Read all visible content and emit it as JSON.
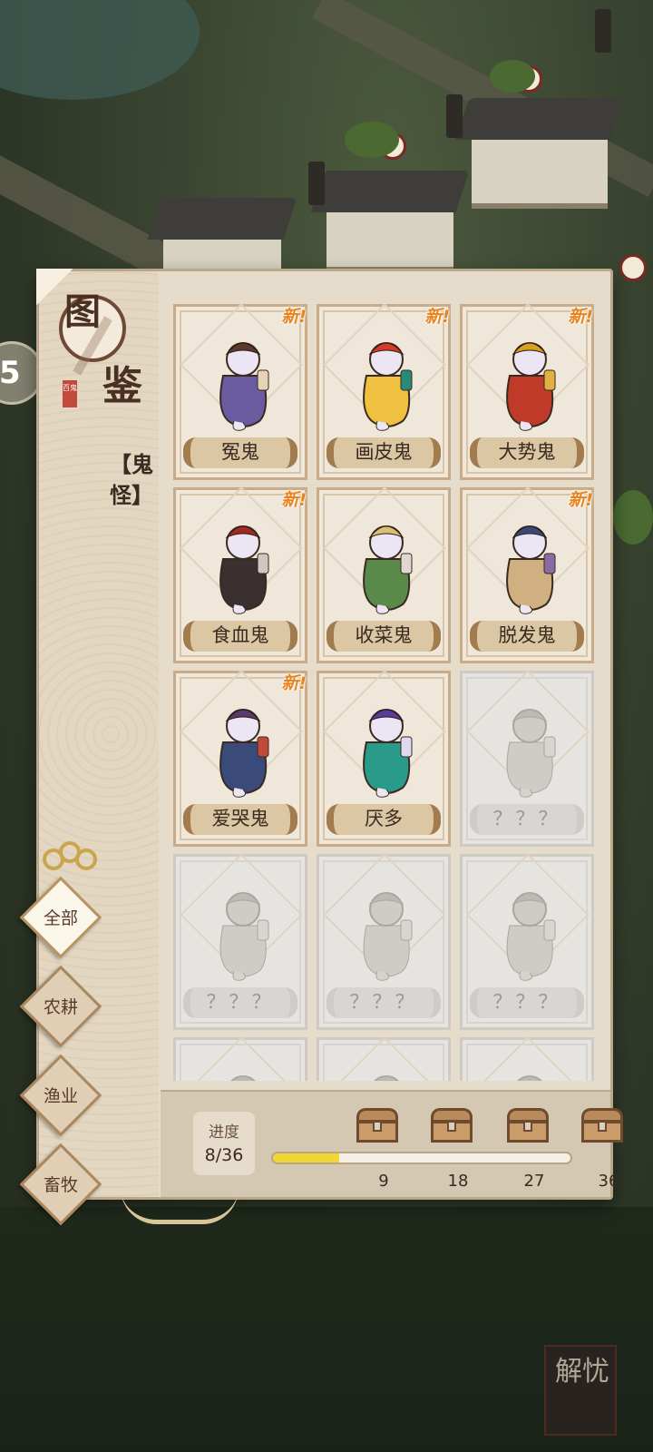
{
  "panel": {
    "title": [
      "图",
      "鉴"
    ],
    "seal_text": "百鬼",
    "category": "【鬼怪】"
  },
  "tabs": [
    {
      "label": "全部",
      "active": true
    },
    {
      "label": "农耕",
      "active": false
    },
    {
      "label": "渔业",
      "active": false
    },
    {
      "label": "畜牧",
      "active": false
    }
  ],
  "new_badge": "新!",
  "cards": [
    {
      "name": "冤鬼",
      "new": true,
      "locked": false
    },
    {
      "name": "画皮鬼",
      "new": true,
      "locked": false
    },
    {
      "name": "大势鬼",
      "new": true,
      "locked": false
    },
    {
      "name": "食血鬼",
      "new": true,
      "locked": false
    },
    {
      "name": "收菜鬼",
      "new": false,
      "locked": false
    },
    {
      "name": "脱发鬼",
      "new": true,
      "locked": false
    },
    {
      "name": "爱哭鬼",
      "new": true,
      "locked": false
    },
    {
      "name": "厌多",
      "new": false,
      "locked": false
    },
    {
      "name": "？？？",
      "new": false,
      "locked": true
    },
    {
      "name": "？？？",
      "new": false,
      "locked": true
    },
    {
      "name": "？？？",
      "new": false,
      "locked": true
    },
    {
      "name": "？？？",
      "new": false,
      "locked": true
    },
    {
      "name": "",
      "new": false,
      "locked": true
    },
    {
      "name": "",
      "new": false,
      "locked": true
    },
    {
      "name": "",
      "new": false,
      "locked": true
    }
  ],
  "progress": {
    "label": "进度",
    "value_text": "8/36",
    "current": 8,
    "max": 36,
    "milestones": [
      "9",
      "18",
      "27",
      "36"
    ]
  },
  "stamp_text": "解忧",
  "colors": {
    "accent": "#e8841e",
    "progress_fill": "#efd832",
    "panel_bg": "#e6dccb"
  }
}
